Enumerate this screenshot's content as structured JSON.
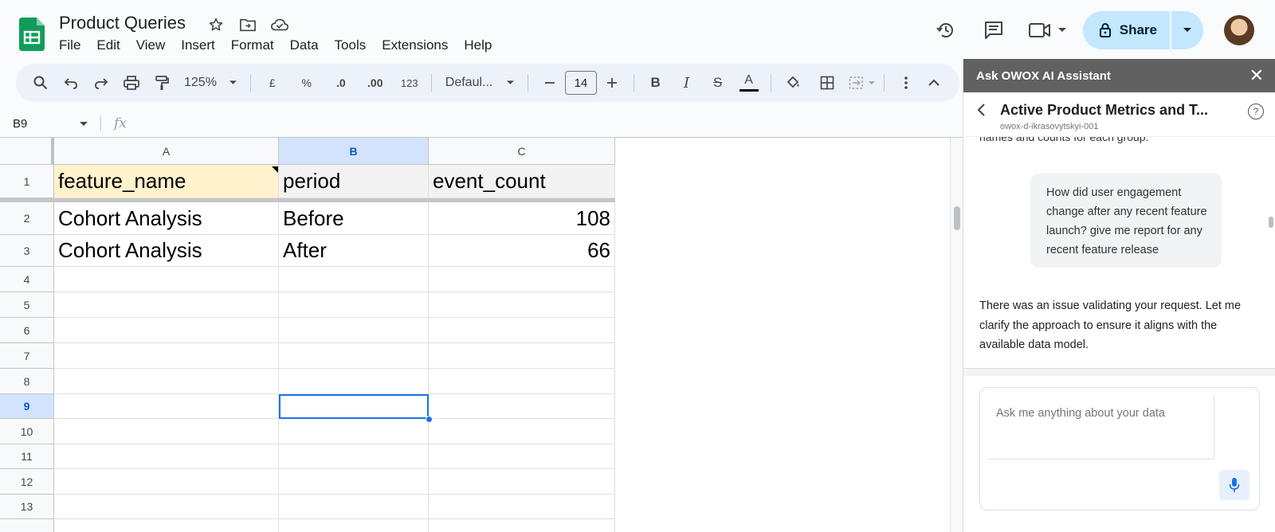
{
  "doc": {
    "title": "Product Queries"
  },
  "menu": [
    "File",
    "Edit",
    "View",
    "Insert",
    "Format",
    "Data",
    "Tools",
    "Extensions",
    "Help"
  ],
  "share": {
    "label": "Share"
  },
  "toolbar": {
    "zoom": "125%",
    "currency": "£",
    "percent": "%",
    "dec_less": ".0",
    "dec_more": ".00",
    "number_format": "123",
    "font": "Defaul...",
    "font_size": "14"
  },
  "formula": {
    "cell_ref": "B9",
    "fx": "fx"
  },
  "columns": [
    "A",
    "B",
    "C"
  ],
  "rows": [
    "1",
    "2",
    "3",
    "4",
    "5",
    "6",
    "7",
    "8",
    "9",
    "10",
    "11",
    "12",
    "13"
  ],
  "table": {
    "headers": [
      "feature_name",
      "period",
      "event_count"
    ],
    "data": [
      [
        "Cohort Analysis",
        "Before",
        "108"
      ],
      [
        "Cohort Analysis",
        "After",
        "66"
      ]
    ]
  },
  "panel": {
    "title": "Ask OWOX AI Assistant",
    "subtitle": "Active Product Metrics and T...",
    "project_id": "owox-d-ikrasovytskyi-001",
    "cut_text": "names and counts for each group.",
    "user_message": "How did user engagement change after any recent feature launch? give me report for any recent feature release",
    "assistant_message": "There was an issue validating your request. Let me clarify the approach to ensure it aligns with the available data model.",
    "input_placeholder": "Ask me anything about your data"
  },
  "colors": {
    "accent": "#1a73e8",
    "share_bg": "#c2e7ff",
    "header_highlight": "#fff2cc",
    "panel_header": "#616161"
  }
}
